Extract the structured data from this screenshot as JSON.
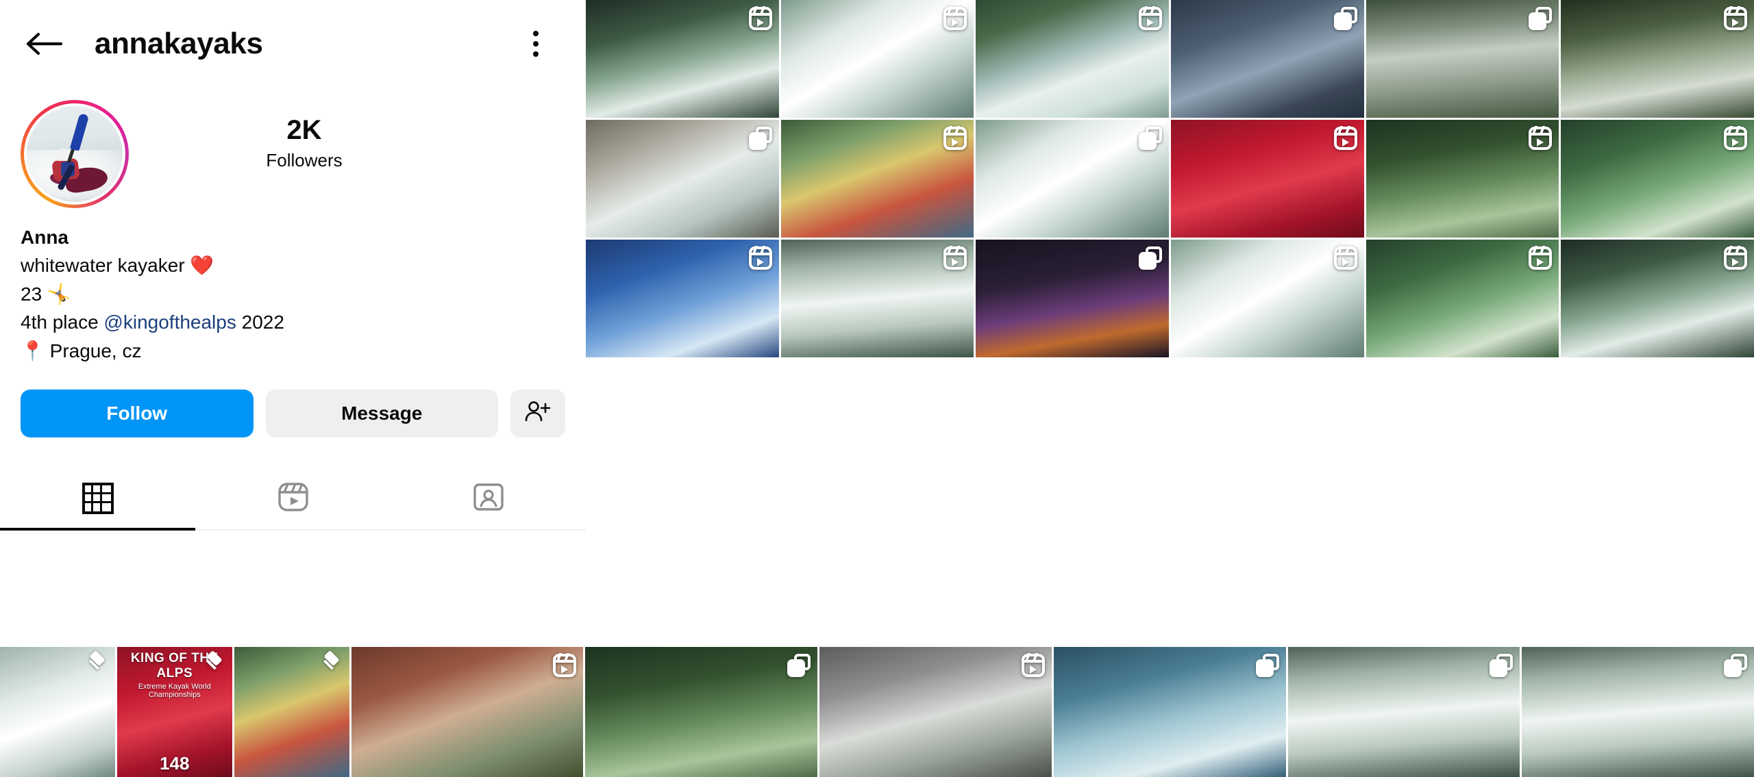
{
  "header": {
    "back_icon": "back-arrow-icon",
    "username": "annakayaks",
    "menu_icon": "overflow-menu-icon"
  },
  "profile": {
    "avatar_alt": "kayaker-avatar",
    "has_story_ring": true,
    "stats": [
      {
        "value": "2K",
        "label": "Followers"
      }
    ],
    "bio": {
      "name": "Anna",
      "lines": [
        "whitewater kayaker ❤️",
        "23 🤸",
        "4th place @kingofthealps 2022",
        "📍 Prague, cz"
      ],
      "line3_prefix": "4th place ",
      "line3_mention": "@kingofthealps",
      "line3_suffix": " 2022"
    },
    "actions": {
      "follow_label": "Follow",
      "message_label": "Message",
      "add_person_icon": "add-person-icon"
    }
  },
  "tabs": [
    {
      "name": "grid",
      "icon": "grid-icon",
      "active": true
    },
    {
      "name": "reels",
      "icon": "reels-icon",
      "active": false
    },
    {
      "name": "tagged",
      "icon": "tagged-person-icon",
      "active": false
    }
  ],
  "colors": {
    "accent_blue": "#0095f6",
    "button_grey": "#efefef",
    "text_primary": "#0a0a0a",
    "mention_blue": "#1b3f7a",
    "tab_inactive": "#8e8e8e"
  },
  "grid": {
    "columns": 6,
    "posts": [
      {
        "art": "w-gorge",
        "overlay": "reels-icon"
      },
      {
        "art": "w-rapids",
        "overlay": "reels-icon"
      },
      {
        "art": "w-river",
        "overlay": "reels-icon"
      },
      {
        "art": "w-car",
        "overlay": "carousel-icon"
      },
      {
        "art": "w-bridge",
        "overlay": "carousel-icon"
      },
      {
        "art": "w-slalom",
        "overlay": "reels-icon"
      },
      {
        "art": "w-rocks",
        "overlay": "carousel-icon"
      },
      {
        "art": "w-boats",
        "overlay": "reels-icon"
      },
      {
        "art": "w-rapids",
        "overlay": "carousel-icon"
      },
      {
        "art": "w-redbib",
        "overlay": "reels-icon"
      },
      {
        "art": "w-forest",
        "overlay": "reels-icon"
      },
      {
        "art": "w-green",
        "overlay": "reels-icon"
      },
      {
        "art": "w-blue",
        "overlay": "reels-icon"
      },
      {
        "art": "w-falls",
        "overlay": "reels-icon"
      },
      {
        "art": "w-night",
        "overlay": "carousel-icon"
      },
      {
        "art": "w-rapids",
        "overlay": "reels-icon"
      },
      {
        "art": "w-green",
        "overlay": "reels-icon"
      },
      {
        "art": "w-gorge",
        "overlay": "reels-icon"
      }
    ],
    "pinned_posts": [
      {
        "art": "w-snow",
        "overlay": "pin-icon"
      },
      {
        "art": "w-redbib",
        "overlay": "pin-icon",
        "caption_title": "KING OF THE ALPS",
        "caption_sub": "Extreme Kayak World Championships",
        "bib": "148"
      },
      {
        "art": "w-boats",
        "overlay": "pin-icon"
      },
      {
        "art": "w-train",
        "overlay": "reels-icon"
      },
      {
        "art": "w-forest",
        "overlay": "carousel-icon"
      },
      {
        "art": "w-dam",
        "overlay": "reels-icon"
      },
      {
        "art": "w-pool",
        "overlay": "carousel-icon"
      },
      {
        "art": "w-falls",
        "overlay": "carousel-icon"
      },
      {
        "art": "w-falls",
        "overlay": "carousel-icon"
      }
    ]
  }
}
